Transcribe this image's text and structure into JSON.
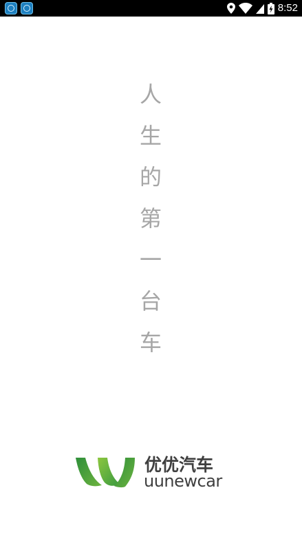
{
  "status_bar": {
    "time": "8:52",
    "notification_icons": [
      "app-notification-icon",
      "app-notification-icon"
    ],
    "icons": [
      "location-icon",
      "wifi-icon",
      "signal-icon",
      "battery-icon"
    ]
  },
  "slogan": {
    "characters": [
      "人",
      "生",
      "的",
      "第",
      "一",
      "台",
      "车"
    ]
  },
  "brand": {
    "name_cn": "优优汽车",
    "name_en": "uunewcar",
    "colors": {
      "green_dark": "#2f8f3a",
      "green_light": "#8cc63f",
      "text": "#3f3f3f"
    }
  }
}
